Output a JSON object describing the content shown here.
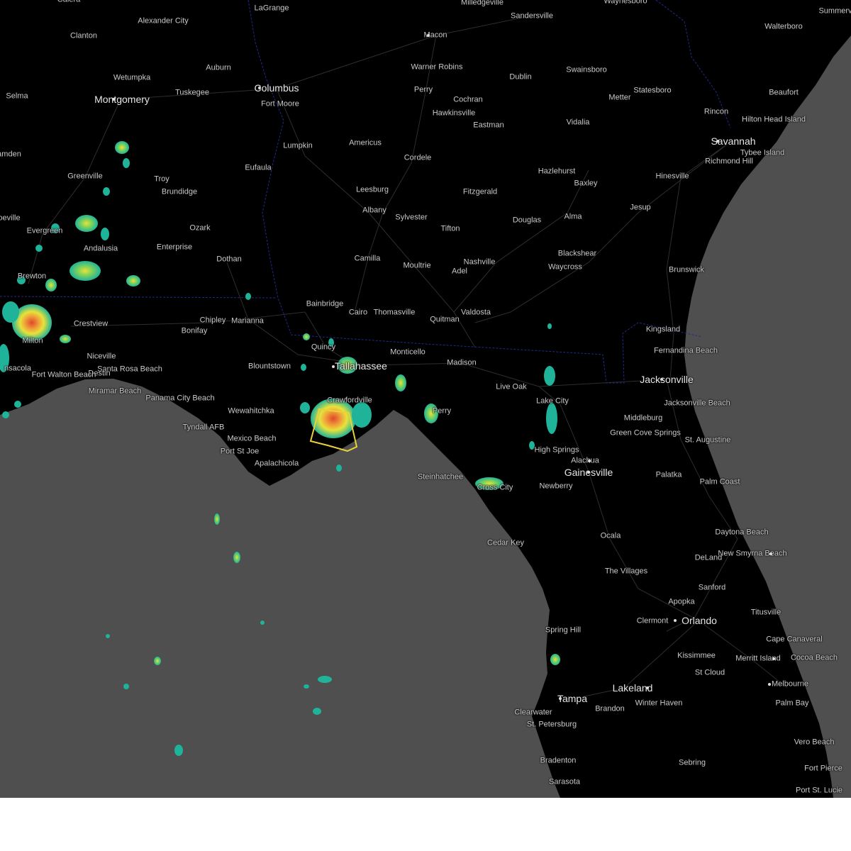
{
  "map": {
    "colors": {
      "land": "#000000",
      "water": "#4f4f4f",
      "roads": "#3a3a3a",
      "state_border": "#1f2a8a",
      "warning_polygon": "#e8d23a",
      "radar_light": "#1fb39a",
      "radar_medium": "#e8e23a",
      "radar_heavy": "#e0472a"
    },
    "cities": [
      {
        "name": "Calera"
      },
      {
        "name": "LaGrange"
      },
      {
        "name": "Milledgeville"
      },
      {
        "name": "Waynesboro"
      },
      {
        "name": "Summerv"
      },
      {
        "name": "Alexander City"
      },
      {
        "name": "Sandersville"
      },
      {
        "name": "Walterboro"
      },
      {
        "name": "Clanton"
      },
      {
        "name": "Macon"
      },
      {
        "name": "Wetumpka"
      },
      {
        "name": "Auburn"
      },
      {
        "name": "Warner Robins"
      },
      {
        "name": "Dublin"
      },
      {
        "name": "Swainsboro"
      },
      {
        "name": "Columbus"
      },
      {
        "name": "Selma"
      },
      {
        "name": "Montgomery"
      },
      {
        "name": "Tuskegee"
      },
      {
        "name": "Perry"
      },
      {
        "name": "Statesboro"
      },
      {
        "name": "Beaufort"
      },
      {
        "name": "Fort Moore"
      },
      {
        "name": "Cochran"
      },
      {
        "name": "Metter"
      },
      {
        "name": "Hawkinsville"
      },
      {
        "name": "Rincon"
      },
      {
        "name": "Hilton Head Island"
      },
      {
        "name": "Eastman"
      },
      {
        "name": "Vidalia"
      },
      {
        "name": "Savannah"
      },
      {
        "name": "Americus"
      },
      {
        "name": "Lumpkin"
      },
      {
        "name": "Tybee Island"
      },
      {
        "name": "Cordele"
      },
      {
        "name": "amden"
      },
      {
        "name": "Eufaula"
      },
      {
        "name": "Richmond Hill"
      },
      {
        "name": "Hazlehurst"
      },
      {
        "name": "Greenville"
      },
      {
        "name": "Hinesville"
      },
      {
        "name": "Troy"
      },
      {
        "name": "Baxley"
      },
      {
        "name": "Leesburg"
      },
      {
        "name": "Fitzgerald"
      },
      {
        "name": "Brundidge"
      },
      {
        "name": "Albany"
      },
      {
        "name": "Jesup"
      },
      {
        "name": "Sylvester"
      },
      {
        "name": "Alma"
      },
      {
        "name": "Douglas"
      },
      {
        "name": "oeville"
      },
      {
        "name": "Ozark"
      },
      {
        "name": "Tifton"
      },
      {
        "name": "Evergreen"
      },
      {
        "name": "Enterprise"
      },
      {
        "name": "Andalusia"
      },
      {
        "name": "Blackshear"
      },
      {
        "name": "Camilla"
      },
      {
        "name": "Dothan"
      },
      {
        "name": "Nashville"
      },
      {
        "name": "Moultrie"
      },
      {
        "name": "Waycross"
      },
      {
        "name": "Brunswick"
      },
      {
        "name": "Adel"
      },
      {
        "name": "Brewton"
      },
      {
        "name": "Bainbridge"
      },
      {
        "name": "Cairo"
      },
      {
        "name": "Thomasville"
      },
      {
        "name": "Valdosta"
      },
      {
        "name": "Chipley"
      },
      {
        "name": "Marianna"
      },
      {
        "name": "Quitman"
      },
      {
        "name": "Crestview"
      },
      {
        "name": "Kingsland"
      },
      {
        "name": "Bonifay"
      },
      {
        "name": "Milton"
      },
      {
        "name": "Quincy"
      },
      {
        "name": "Fernandina Beach"
      },
      {
        "name": "Monticello"
      },
      {
        "name": "Niceville"
      },
      {
        "name": "Tallahassee"
      },
      {
        "name": "Santa Rosa Beach"
      },
      {
        "name": "Madison"
      },
      {
        "name": "Blountstown"
      },
      {
        "name": "Destin"
      },
      {
        "name": "Fort Walton Beach"
      },
      {
        "name": "nsacola"
      },
      {
        "name": "Jacksonville"
      },
      {
        "name": "Live Oak"
      },
      {
        "name": "Miramar Beach"
      },
      {
        "name": "Panama City Beach"
      },
      {
        "name": "Jacksonville Beach"
      },
      {
        "name": "Crawfordville"
      },
      {
        "name": "Lake City"
      },
      {
        "name": "Wewahitchka"
      },
      {
        "name": "Perry"
      },
      {
        "name": "Middleburg"
      },
      {
        "name": "Tyndall AFB"
      },
      {
        "name": "Green Cove Springs"
      },
      {
        "name": "Mexico Beach"
      },
      {
        "name": "St. Augustine"
      },
      {
        "name": "Port St Joe"
      },
      {
        "name": "High Springs"
      },
      {
        "name": "Alachua"
      },
      {
        "name": "Apalachicola"
      },
      {
        "name": "Gainesville"
      },
      {
        "name": "Palatka"
      },
      {
        "name": "Steinhatchee"
      },
      {
        "name": "Palm Coast"
      },
      {
        "name": "Cross City"
      },
      {
        "name": "Newberry"
      },
      {
        "name": "Daytona Beach"
      },
      {
        "name": "Ocala"
      },
      {
        "name": "New Smyrna Beach"
      },
      {
        "name": "Cedar Key"
      },
      {
        "name": "DeLand"
      },
      {
        "name": "The Villages"
      },
      {
        "name": "Sanford"
      },
      {
        "name": "Apopka"
      },
      {
        "name": "Titusville"
      },
      {
        "name": "Clermont"
      },
      {
        "name": "Orlando"
      },
      {
        "name": "Spring Hill"
      },
      {
        "name": "Cape Canaveral"
      },
      {
        "name": "Kissimmee"
      },
      {
        "name": "Merritt Island"
      },
      {
        "name": "Cocoa Beach"
      },
      {
        "name": "St Cloud"
      },
      {
        "name": "Melbourne"
      },
      {
        "name": "Lakeland"
      },
      {
        "name": "Tampa"
      },
      {
        "name": "Brandon"
      },
      {
        "name": "Winter Haven"
      },
      {
        "name": "Palm Bay"
      },
      {
        "name": "Clearwater"
      },
      {
        "name": "St. Petersburg"
      },
      {
        "name": "Vero Beach"
      },
      {
        "name": "Bradenton"
      },
      {
        "name": "Sebring"
      },
      {
        "name": "Fort Pierce"
      },
      {
        "name": "Sarasota"
      },
      {
        "name": "Port St. Lucie"
      }
    ]
  }
}
